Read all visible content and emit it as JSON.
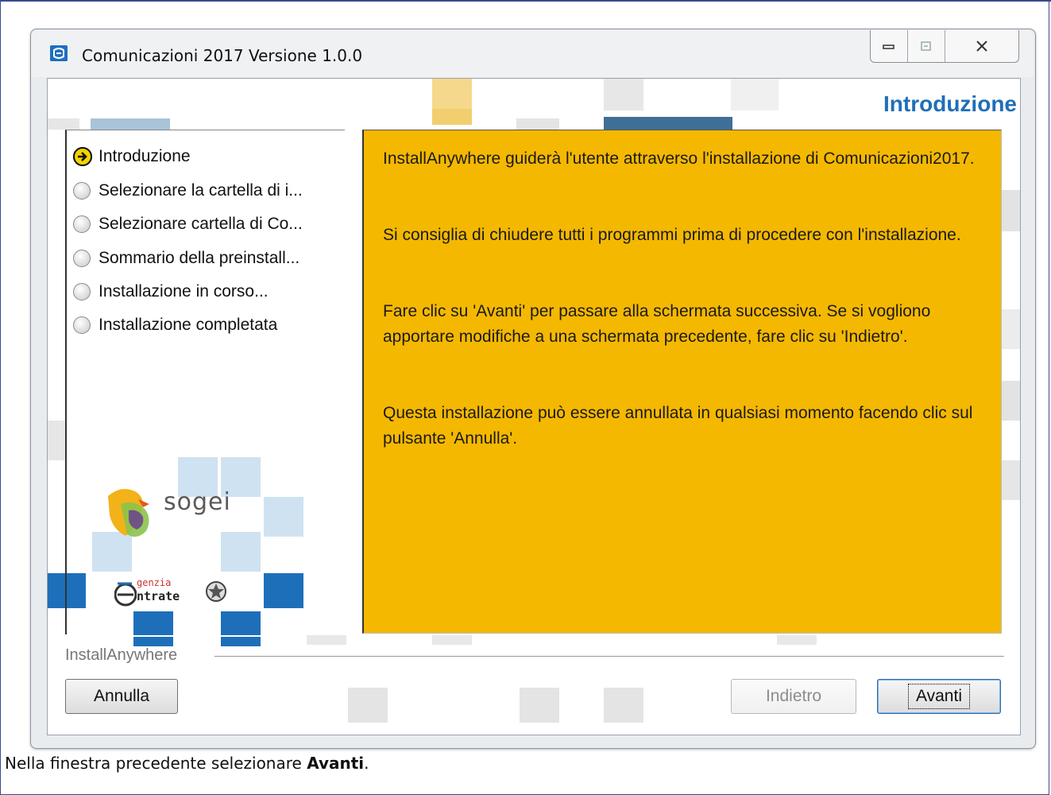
{
  "window": {
    "title": "Comunicazioni 2017 Versione 1.0.0",
    "controls": {
      "minimize": "minimize",
      "maximize": "maximize",
      "close": "close"
    }
  },
  "page_heading": "Introduzione",
  "steps": [
    {
      "label": "Introduzione",
      "state": "current"
    },
    {
      "label": "Selezionare la cartella di i...",
      "state": "pending"
    },
    {
      "label": "Selezionare cartella di Co...",
      "state": "pending"
    },
    {
      "label": "Sommario della preinstall...",
      "state": "pending"
    },
    {
      "label": "Installazione in corso...",
      "state": "pending"
    },
    {
      "label": "Installazione completata",
      "state": "pending"
    }
  ],
  "content": {
    "paragraphs": [
      "InstallAnywhere guiderà l'utente attraverso l'installazione di Comunicazioni2017.",
      "Si consiglia di chiudere tutti i programmi prima di procedere con l'installazione.",
      "Fare clic su 'Avanti' per passare alla schermata successiva. Se si vogliono apportare modifiche a una schermata precedente, fare clic su 'Indietro'.",
      "Questa installazione può essere annullata in qualsiasi momento facendo clic sul pulsante 'Annulla'."
    ]
  },
  "logos": {
    "sogei": "sogei",
    "agenzia_top": "genzia",
    "agenzia_bottom": "ntrate"
  },
  "footer": {
    "brand": "InstallAnywhere"
  },
  "buttons": {
    "cancel": "Annulla",
    "back": "Indietro",
    "next": "Avanti"
  },
  "caption": {
    "prefix": "Nella finestra precedente selezionare ",
    "bold": "Avanti",
    "suffix": "."
  },
  "colors": {
    "accent": "#1f6fb7",
    "panel": "#f5b800"
  }
}
